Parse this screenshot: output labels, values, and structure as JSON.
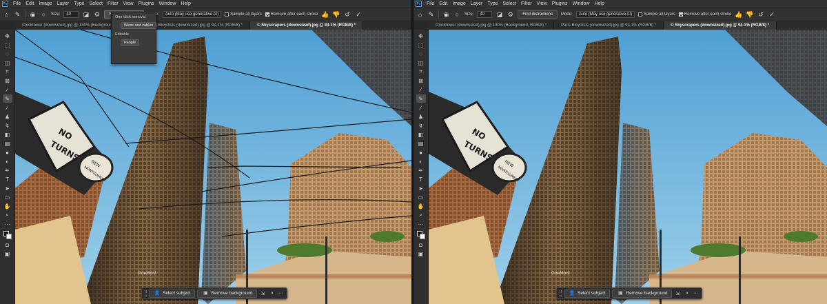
{
  "app": {
    "logo": "Ps"
  },
  "menu": [
    "File",
    "Edit",
    "Image",
    "Layer",
    "Type",
    "Select",
    "Filter",
    "View",
    "Plugins",
    "Window",
    "Help"
  ],
  "options": {
    "size_label": "Size:",
    "size_value": "40",
    "find_distractions": "Find distractions",
    "mode_label": "Mode:",
    "mode_value": "Auto (May use generative AI)",
    "sample_all_layers": "Sample all layers",
    "remove_after_stroke": "Remove after each stroke"
  },
  "tabs_left": [
    "Clocktower (downsized).jpg @ 130% (Background, RGB/8) *",
    "Paris Bicyclists (downsized).jpg @ 94.1% (RGB/8) *",
    "© Skyscrapers (downsized).jpg @ 94.1% (RGB/8) *"
  ],
  "tabs_right": [
    "Clocktower (downsized).jpg @ 130% (Background, RGB/8) *",
    "Paris Bicyclists (downsized).jpg @ 94.1% (RGB/8) *",
    "© Skyscrapers (downsized).jpg @ 94.1% (RGB/8) *"
  ],
  "flyout": {
    "one_click": "One-click removal",
    "wires": "Wires and cables",
    "editable": "Editable",
    "people": "People"
  },
  "contextbar": {
    "select_subject": "Select subject",
    "remove_background": "Remove background"
  },
  "image": {
    "sign_text_1": "NO",
    "sign_text_2": "TURNS",
    "street_sign_1": "NEW",
    "street_sign_2": "MONTGOMERY",
    "building_sign": "OneMont"
  },
  "colors": {
    "sky": "#6fb3da",
    "accent": "#31a8ff"
  }
}
